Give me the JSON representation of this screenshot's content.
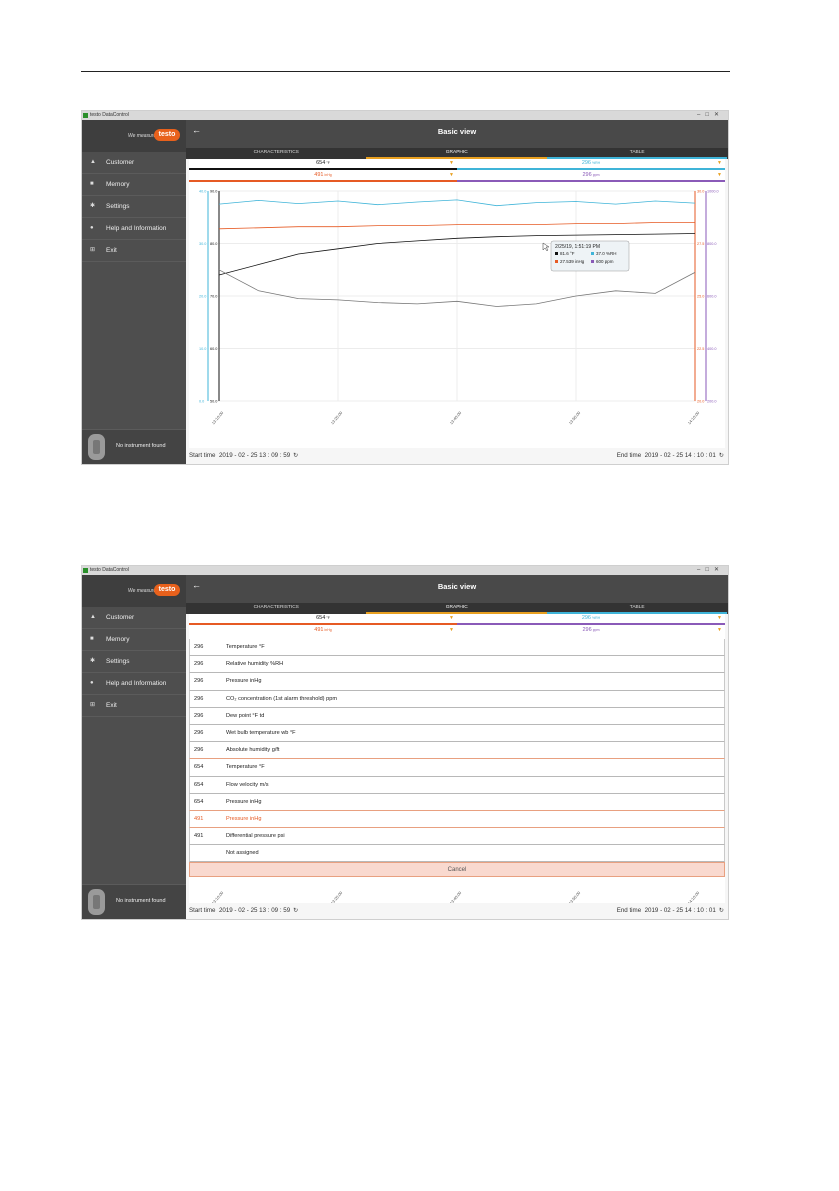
{
  "colors": {
    "accent": "#e8611c",
    "cyan": "#3fb4d8",
    "black": "#111111",
    "orange": "#e65a24",
    "purple": "#8a5ab8"
  },
  "app": {
    "window_title": "testo DataControl",
    "tagline": "We measure.",
    "brand": "testo"
  },
  "sidebar": {
    "items": [
      {
        "icon": "person-icon",
        "label": "Customer"
      },
      {
        "icon": "memory-icon",
        "label": "Memory"
      },
      {
        "icon": "gear-icon",
        "label": "Settings"
      },
      {
        "icon": "help-icon",
        "label": "Help and Information"
      },
      {
        "icon": "exit-icon",
        "label": "Exit"
      }
    ],
    "instrument_status": "No instrument found"
  },
  "header": {
    "title": "Basic view"
  },
  "tabs": [
    {
      "label": "CHARACTERISTICS"
    },
    {
      "label": "GRAPHIC"
    },
    {
      "label": "TABLE"
    }
  ],
  "measure_bars": {
    "top_left": {
      "value": "654",
      "unit": "°F"
    },
    "top_right": {
      "value": "296",
      "unit": "%RH"
    },
    "bottom_left": {
      "value": "491",
      "unit": "inHg"
    },
    "bottom_right": {
      "value": "296",
      "unit": "ppm"
    }
  },
  "footer": {
    "start_label": "Start time",
    "start_value": "2019 - 02 - 25   13 : 09 : 59",
    "end_label": "End time",
    "end_value": "2019 - 02 - 25   14 : 10 : 01"
  },
  "tooltip": {
    "date": "2/25/19, 1:51:19 PM",
    "temp": "81.6 °F",
    "rh": "37.0 %RH",
    "pressure": "27.539 inHg",
    "co2": "600 ppm"
  },
  "chart_data": {
    "type": "line",
    "x_ticks": [
      "13:10:00",
      "13:25:00",
      "13:40:00",
      "13:55:00",
      "14:10:00"
    ],
    "left_axis_cyan_ticks": [
      "40.0",
      "30.0",
      "20.0",
      "10.0",
      "0.0"
    ],
    "left_axis_black_ticks": [
      "90.0",
      "80.0",
      "70.0",
      "60.0",
      "50.0"
    ],
    "right_axis_orange_ticks": [
      "30.0",
      "27.5",
      "25.0",
      "22.5",
      "20.0"
    ],
    "right_axis_purple_ticks": [
      "1000.0",
      "800.0",
      "600.0",
      "400.0",
      "200.0"
    ],
    "series": [
      {
        "name": "°F",
        "color": "#111111",
        "values": [
          74,
          76,
          78,
          79,
          80,
          80.5,
          81,
          81.3,
          81.5,
          81.6,
          81.7,
          81.8,
          81.9
        ]
      },
      {
        "name": "%RH",
        "color": "#3fb4d8",
        "values": [
          37.5,
          38.2,
          37.6,
          38.1,
          37.4,
          37.9,
          38.3,
          37.2,
          37.8,
          38.0,
          37.5,
          38.1,
          37.7
        ]
      },
      {
        "name": "inHg",
        "color": "#e65a24",
        "values": [
          28.2,
          28.25,
          28.3,
          28.3,
          28.35,
          28.35,
          28.4,
          28.4,
          28.4,
          28.45,
          28.45,
          28.5,
          28.5
        ]
      },
      {
        "name": "ppm",
        "color": "#777777",
        "values": [
          700,
          620,
          590,
          585,
          575,
          570,
          580,
          560,
          570,
          600,
          620,
          610,
          690
        ]
      }
    ]
  },
  "dropdown": {
    "items": [
      {
        "num": "296",
        "label": "Temperature °F"
      },
      {
        "num": "296",
        "label": "Relative humidity %RH"
      },
      {
        "num": "296",
        "label": "Pressure inHg"
      },
      {
        "num": "296",
        "label": "CO₂ concentration (1st alarm threshold) ppm"
      },
      {
        "num": "296",
        "label": "Dew point °F td"
      },
      {
        "num": "296",
        "label": "Wet bulb temperature wb °F"
      },
      {
        "num": "296",
        "label": "Absolute humidity g/ft"
      },
      {
        "num": "654",
        "label": "Temperature °F"
      },
      {
        "num": "654",
        "label": "Flow velocity m/s"
      },
      {
        "num": "654",
        "label": "Pressure inHg"
      },
      {
        "num": "491",
        "label": "Pressure inHg"
      },
      {
        "num": "491",
        "label": "Differential pressure psi"
      },
      {
        "num": "",
        "label": "Not assigned"
      }
    ],
    "cancel": "Cancel"
  }
}
